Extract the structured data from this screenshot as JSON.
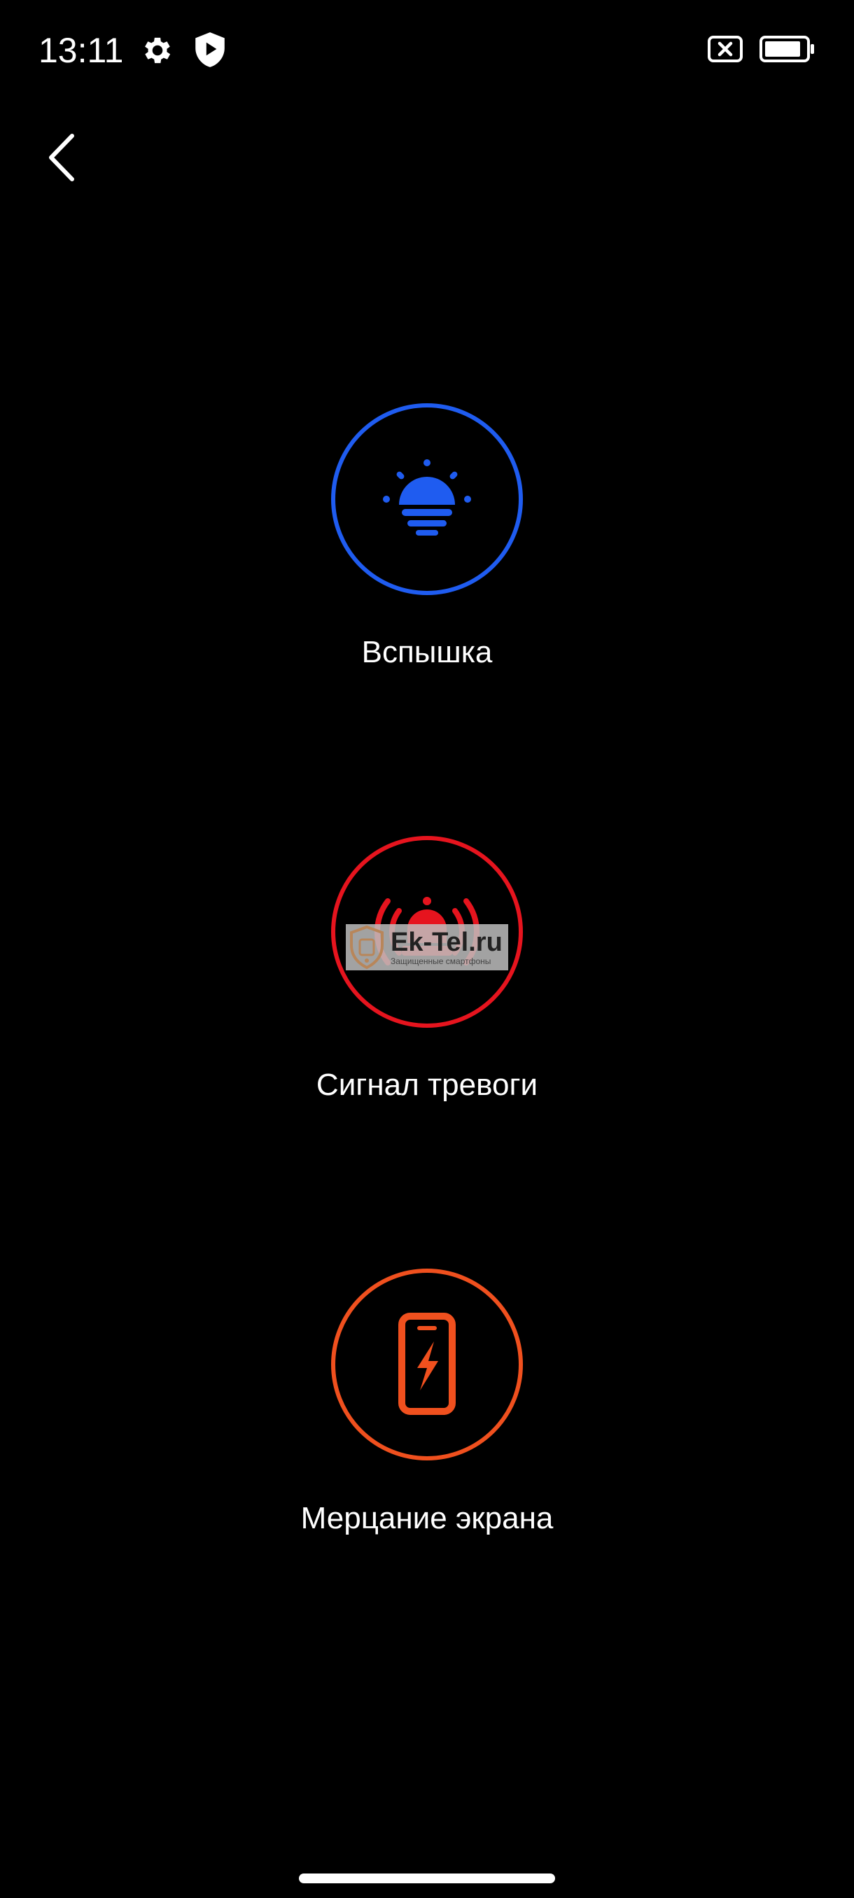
{
  "status_bar": {
    "time": "13:11",
    "icons": [
      "gear-icon",
      "shield-play-icon",
      "close-box-icon",
      "battery-icon"
    ]
  },
  "navigation": {
    "back_icon": "chevron-left-icon"
  },
  "modes": [
    {
      "label": "Вспышка",
      "icon": "lightbulb-icon",
      "color": "#1f5cf0"
    },
    {
      "label": "Сигнал тревоги",
      "icon": "alarm-bell-icon",
      "color": "#e6141e"
    },
    {
      "label": "Мерцание экрана",
      "icon": "phone-flash-icon",
      "color": "#f0501e"
    }
  ],
  "watermark": {
    "title": "Ek-Tel.ru",
    "subtitle": "Защищенные смартфоны"
  },
  "colors": {
    "background": "#000000",
    "text": "#ffffff"
  }
}
